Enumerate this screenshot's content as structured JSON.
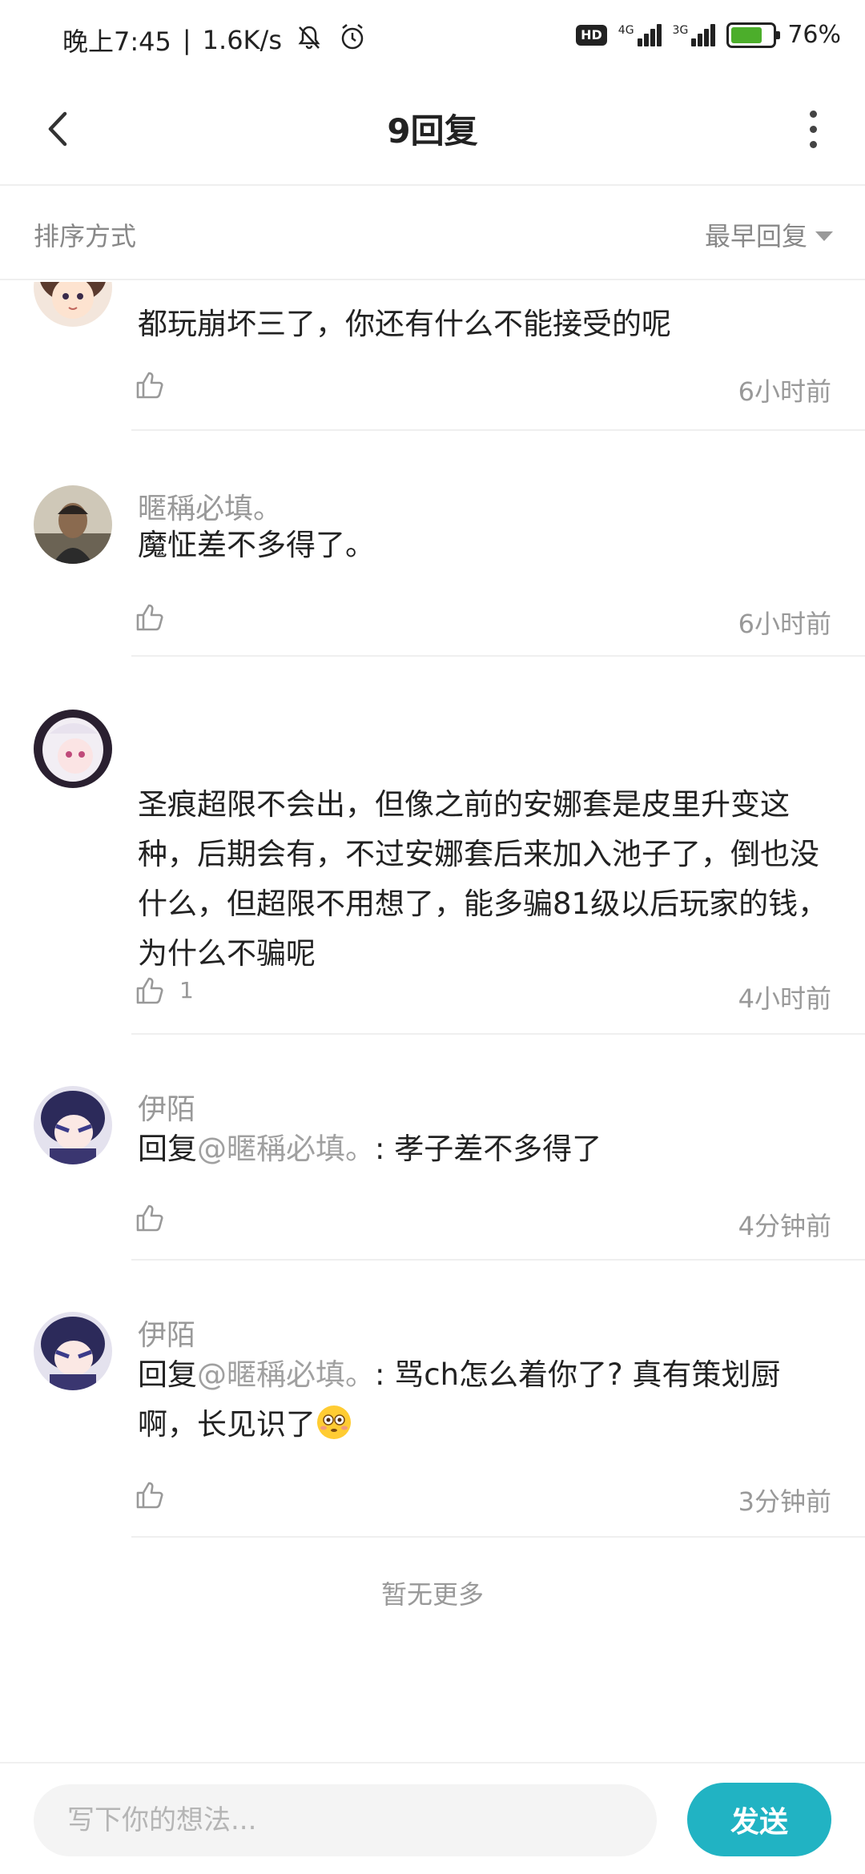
{
  "status_bar": {
    "time": "晚上7:45",
    "net_speed": "1.6K/s",
    "hd": "HD",
    "net1": "4G",
    "net2": "3G",
    "battery": "76%",
    "battery_level": 0.76
  },
  "header": {
    "title": "9回复"
  },
  "sort": {
    "label": "排序方式",
    "value": "最早回复"
  },
  "comments": [
    {
      "username": "",
      "text": "都玩崩坏三了，你还有什么不能接受的呢",
      "likes": "",
      "time": "6小时前"
    },
    {
      "username": "暱稱必填。",
      "text": "魔怔差不多得了。",
      "likes": "",
      "time": "6小时前"
    },
    {
      "username": "",
      "text": "圣痕超限不会出，但像之前的安娜套是皮里升变这种，后期会有，不过安娜套后来加入池子了，倒也没什么，但超限不用想了，能多骗81级以后玩家的钱，为什么不骗呢",
      "likes": "1",
      "time": "4小时前"
    },
    {
      "username": "伊陌",
      "reply_prefix": "回复",
      "mention": "@暱稱必填。",
      "text": ": 孝子差不多得了",
      "likes": "",
      "time": "4分钟前"
    },
    {
      "username": "伊陌",
      "reply_prefix": "回复",
      "mention": "@暱稱必填。",
      "text": ": 骂ch怎么着你了? 真有策划厨啊，长见识了",
      "likes": "",
      "time": "3分钟前"
    }
  ],
  "no_more": "暂无更多",
  "composer": {
    "placeholder": "写下你的想法...",
    "send_label": "发送"
  },
  "colors": {
    "accent": "#21b3c3",
    "battery": "#4cae2b"
  }
}
